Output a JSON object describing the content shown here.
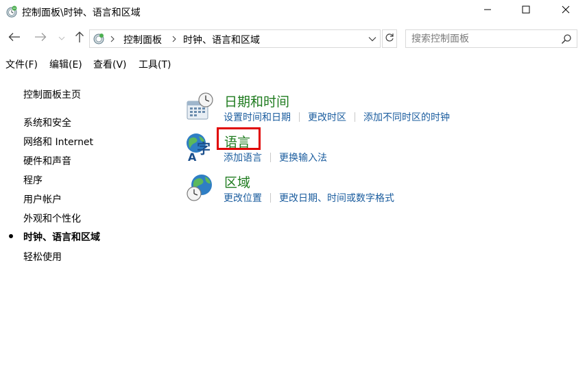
{
  "window": {
    "title": "控制面板\\时钟、语言和区域",
    "minimize_icon": "minimize-icon",
    "maximize_icon": "maximize-icon",
    "close_icon": "close-icon"
  },
  "navigation": {
    "breadcrumbs": [
      "控制面板",
      "时钟、语言和区域"
    ],
    "search_placeholder": "搜索控制面板"
  },
  "menu": [
    "文件(F)",
    "编辑(E)",
    "查看(V)",
    "工具(T)"
  ],
  "sidebar": {
    "items": [
      {
        "label": "控制面板主页",
        "active": false
      },
      {
        "label": "系统和安全",
        "active": false
      },
      {
        "label": "网络和 Internet",
        "active": false
      },
      {
        "label": "硬件和声音",
        "active": false
      },
      {
        "label": "程序",
        "active": false
      },
      {
        "label": "用户帐户",
        "active": false
      },
      {
        "label": "外观和个性化",
        "active": false
      },
      {
        "label": "时钟、语言和区域",
        "active": true
      },
      {
        "label": "轻松使用",
        "active": false
      }
    ]
  },
  "categories": [
    {
      "title": "日期和时间",
      "icon": "date-time-icon",
      "links": [
        "设置时间和日期",
        "更改时区",
        "添加不同时区的时钟"
      ]
    },
    {
      "title": "语言",
      "icon": "language-icon",
      "links": [
        "添加语言",
        "更换输入法"
      ],
      "highlighted": true
    },
    {
      "title": "区域",
      "icon": "region-icon",
      "links": [
        "更改位置",
        "更改日期、时间或数字格式"
      ]
    }
  ],
  "colors": {
    "category_title": "#1e7b1e",
    "link": "#1a5c9e",
    "highlight": "#e00000"
  }
}
